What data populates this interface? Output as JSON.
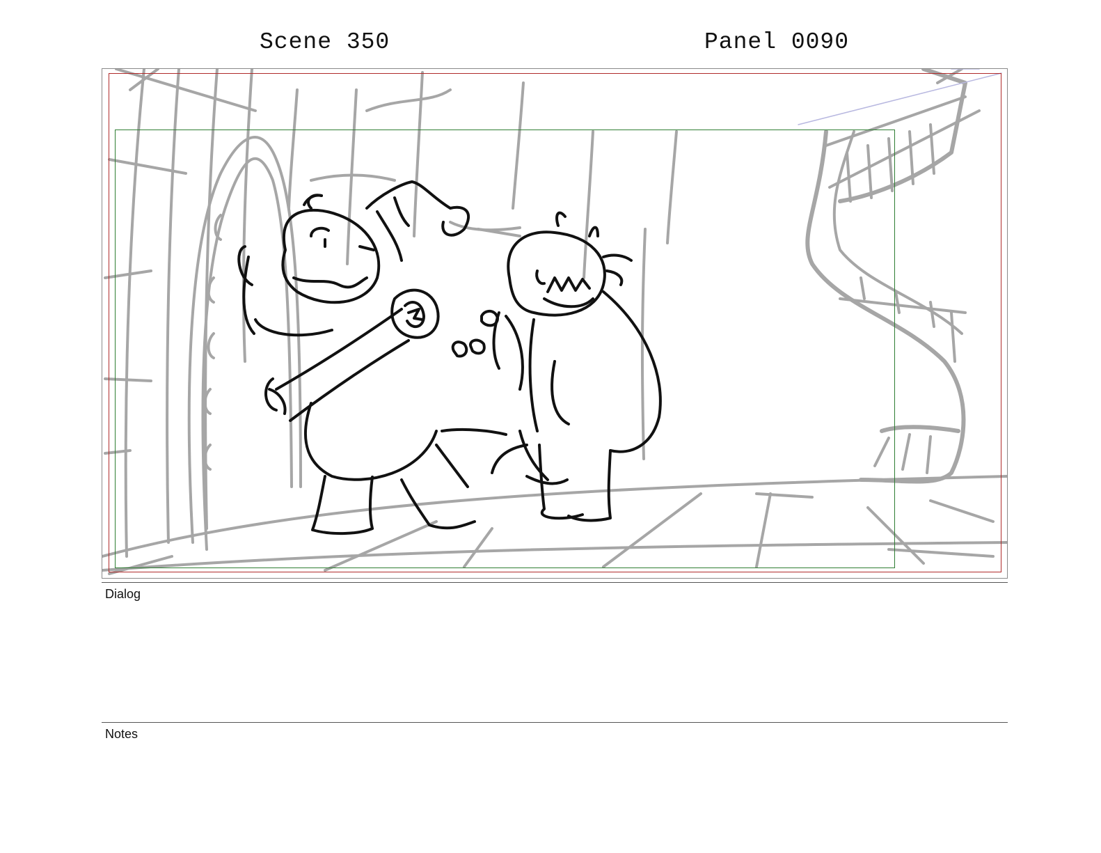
{
  "header": {
    "scene": "Scene 350",
    "panel": "Panel 0090"
  },
  "sections": {
    "dialog_label": "Dialog",
    "dialog_text": "",
    "notes_label": "Notes",
    "notes_text": ""
  },
  "colors": {
    "action_safe": "#b02a2a",
    "title_safe": "#2e7d32",
    "sketch_line": "#111111",
    "background_sketch": "#a6a6a6"
  }
}
